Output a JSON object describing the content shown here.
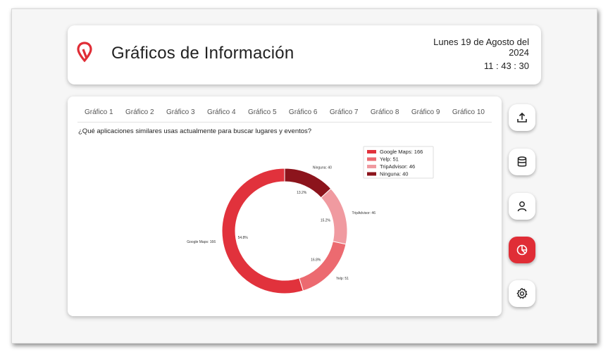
{
  "header": {
    "title": "Gráficos de Información",
    "date_line1": "Lunes 19 de Agosto del",
    "date_line2": "2024",
    "time": "11 : 43 : 30"
  },
  "tabs": [
    "Gráfico 1",
    "Gráfico 2",
    "Gráfico 3",
    "Gráfico 4",
    "Gráfico 5",
    "Gráfico 6",
    "Gráfico 7",
    "Gráfico 8",
    "Gráfico 9",
    "Gráfico 10"
  ],
  "question": "¿Qué aplicaciones similares usas actualmente para buscar lugares y eventos?",
  "chart_data": {
    "type": "pie",
    "variant": "donut",
    "title": "",
    "categories": [
      "Google Maps",
      "Yelp",
      "TripAdvisor",
      "Ninguna"
    ],
    "values": [
      166,
      51,
      46,
      40
    ],
    "percent_labels": [
      "54.8%",
      "16.8%",
      "15.2%",
      "13.2%"
    ],
    "slice_labels": [
      "Google Maps: 166",
      "Yelp: 51",
      "TripAdvisor: 46",
      "Ninguna: 40"
    ],
    "legend": [
      "Google Maps: 166",
      "Yelp: 51",
      "TripAdvisor: 46",
      "Ninguna: 40"
    ],
    "legend_position": "top-right",
    "colors": [
      "#e1323c",
      "#ec6a70",
      "#f09aa0",
      "#8c141c"
    ]
  },
  "sidebar": [
    {
      "icon": "upload-icon",
      "active": false
    },
    {
      "icon": "database-icon",
      "active": false
    },
    {
      "icon": "user-icon",
      "active": false
    },
    {
      "icon": "pie-chart-icon",
      "active": true
    },
    {
      "icon": "gear-icon",
      "active": false
    }
  ],
  "colors": {
    "accent": "#e02d36"
  }
}
